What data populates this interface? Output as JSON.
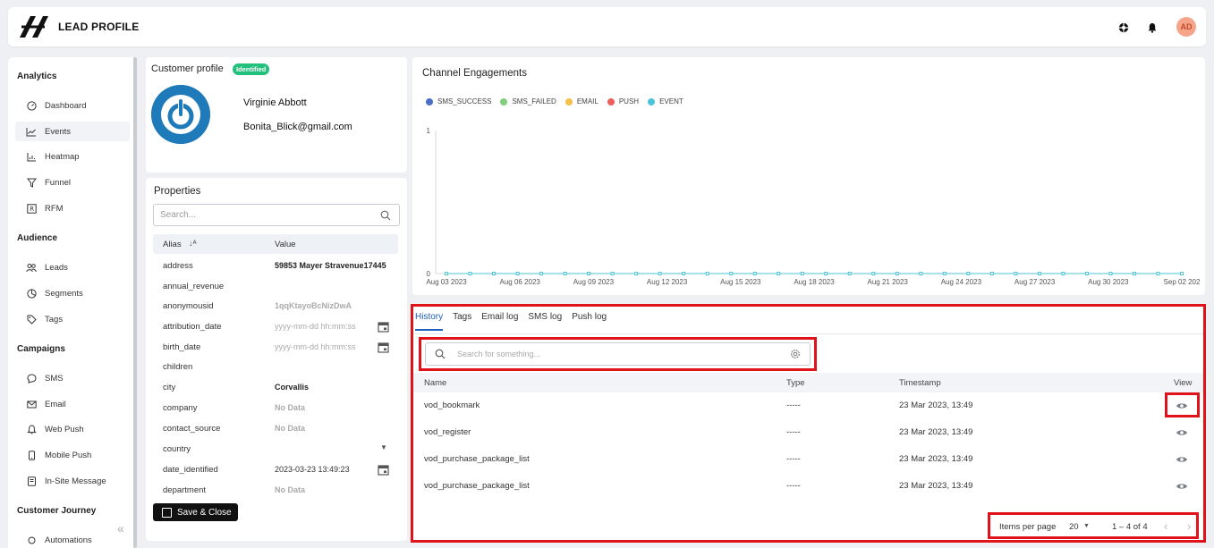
{
  "app": {
    "title": "LEAD PROFILE",
    "avatar_initials": "AD"
  },
  "sidebar": {
    "sections": [
      {
        "label": "Analytics"
      },
      {
        "label": "Audience"
      },
      {
        "label": "Campaigns"
      },
      {
        "label": "Customer Journey"
      }
    ],
    "items": [
      {
        "label": "Dashboard",
        "icon": "dashboard-icon"
      },
      {
        "label": "Events",
        "icon": "chart-line-icon",
        "active": true
      },
      {
        "label": "Heatmap",
        "icon": "heatmap-icon"
      },
      {
        "label": "Funnel",
        "icon": "funnel-icon"
      },
      {
        "label": "RFM",
        "icon": "rfm-icon"
      },
      {
        "label": "Leads",
        "icon": "users-icon"
      },
      {
        "label": "Segments",
        "icon": "pie-icon"
      },
      {
        "label": "Tags",
        "icon": "tag-icon"
      },
      {
        "label": "SMS",
        "icon": "chat-icon"
      },
      {
        "label": "Email",
        "icon": "mail-icon"
      },
      {
        "label": "Web Push",
        "icon": "bell-icon"
      },
      {
        "label": "Mobile Push",
        "icon": "mobile-icon"
      },
      {
        "label": "In-Site Message",
        "icon": "message-icon"
      },
      {
        "label": "Automations",
        "icon": "automation-icon"
      }
    ]
  },
  "profile": {
    "title": "Customer profile",
    "badge": "Identified",
    "name": "Virginie Abbott",
    "email": "Bonita_Blick@gmail.com"
  },
  "properties": {
    "title": "Properties",
    "search_placeholder": "Search...",
    "col_alias": "Alias",
    "col_value": "Value",
    "rows": [
      {
        "alias": "address",
        "value": "59853 Mayer Stravenue17445"
      },
      {
        "alias": "annual_revenue",
        "value": ""
      },
      {
        "alias": "anonymousid",
        "value": "1qqKtayoBcNizDwA"
      },
      {
        "alias": "attribution_date",
        "value": "yyyy-mm-dd hh:mm:ss"
      },
      {
        "alias": "birth_date",
        "value": "yyyy-mm-dd hh:mm:ss"
      },
      {
        "alias": "children",
        "value": ""
      },
      {
        "alias": "city",
        "value": "Corvallis"
      },
      {
        "alias": "company",
        "value": "No Data"
      },
      {
        "alias": "contact_source",
        "value": "No Data"
      },
      {
        "alias": "country",
        "value": ""
      },
      {
        "alias": "date_identified",
        "value": "2023-03-23 13:49:23"
      },
      {
        "alias": "department",
        "value": "No Data"
      }
    ],
    "save_label": "Save & Close"
  },
  "chart_data": {
    "type": "line",
    "title": "Channel Engagements",
    "series": [
      {
        "name": "SMS_SUCCESS",
        "color": "#4a6fc2"
      },
      {
        "name": "SMS_FAILED",
        "color": "#7ed07a"
      },
      {
        "name": "EMAIL",
        "color": "#f6c04a"
      },
      {
        "name": "PUSH",
        "color": "#ef5c5c"
      },
      {
        "name": "EVENT",
        "color": "#4cc3d9"
      }
    ],
    "x_ticks": [
      "Aug 03 2023",
      "Aug 06 2023",
      "Aug 09 2023",
      "Aug 12 2023",
      "Aug 15 2023",
      "Aug 18 2023",
      "Aug 21 2023",
      "Aug 24 2023",
      "Aug 27 2023",
      "Aug 30 2023",
      "Sep 02 202"
    ],
    "y_ticks": [
      "1",
      "0"
    ],
    "ylim": [
      0,
      1
    ],
    "points": 32,
    "value": 0
  },
  "history": {
    "tabs": [
      "History",
      "Tags",
      "Email log",
      "SMS log",
      "Push log"
    ],
    "search_placeholder": "Search for something...",
    "columns": [
      "Name",
      "Type",
      "Timestamp",
      "View"
    ],
    "rows": [
      {
        "name": "vod_bookmark",
        "type": "-----",
        "timestamp": "23 Mar 2023, 13:49"
      },
      {
        "name": "vod_register",
        "type": "-----",
        "timestamp": "23 Mar 2023, 13:49"
      },
      {
        "name": "vod_purchase_package_list",
        "type": "-----",
        "timestamp": "23 Mar 2023, 13:49"
      },
      {
        "name": "vod_purchase_package_list",
        "type": "-----",
        "timestamp": "23 Mar 2023, 13:49"
      }
    ],
    "pager": {
      "label": "Items per page",
      "size": "20",
      "range": "1 – 4 of 4"
    }
  }
}
